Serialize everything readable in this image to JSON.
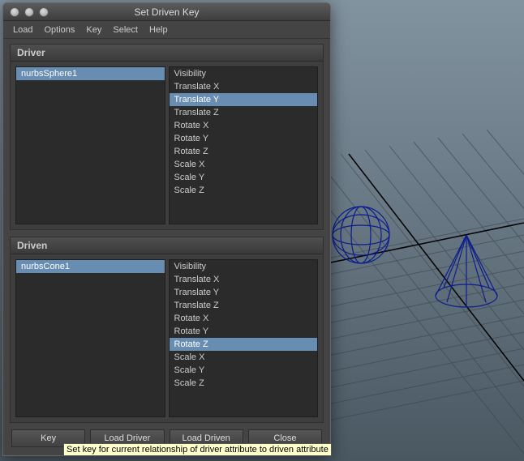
{
  "window": {
    "title": "Set Driven Key"
  },
  "menu": {
    "items": [
      "Load",
      "Options",
      "Key",
      "Select",
      "Help"
    ]
  },
  "driver": {
    "header": "Driver",
    "objects": [
      {
        "name": "nurbsSphere1",
        "selected": true
      }
    ],
    "attributes": [
      {
        "name": "Visibility",
        "selected": false
      },
      {
        "name": "Translate X",
        "selected": false
      },
      {
        "name": "Translate Y",
        "selected": true
      },
      {
        "name": "Translate Z",
        "selected": false
      },
      {
        "name": "Rotate X",
        "selected": false
      },
      {
        "name": "Rotate Y",
        "selected": false
      },
      {
        "name": "Rotate Z",
        "selected": false
      },
      {
        "name": "Scale X",
        "selected": false
      },
      {
        "name": "Scale Y",
        "selected": false
      },
      {
        "name": "Scale Z",
        "selected": false
      }
    ]
  },
  "driven": {
    "header": "Driven",
    "objects": [
      {
        "name": "nurbsCone1",
        "selected": true
      }
    ],
    "attributes": [
      {
        "name": "Visibility",
        "selected": false
      },
      {
        "name": "Translate X",
        "selected": false
      },
      {
        "name": "Translate Y",
        "selected": false
      },
      {
        "name": "Translate Z",
        "selected": false
      },
      {
        "name": "Rotate X",
        "selected": false
      },
      {
        "name": "Rotate Y",
        "selected": false
      },
      {
        "name": "Rotate Z",
        "selected": true
      },
      {
        "name": "Scale X",
        "selected": false
      },
      {
        "name": "Scale Y",
        "selected": false
      },
      {
        "name": "Scale Z",
        "selected": false
      }
    ]
  },
  "buttons": {
    "key": "Key",
    "load_driver": "Load Driver",
    "load_driven": "Load Driven",
    "close": "Close"
  },
  "tooltip": "Set key for current relationship of driver attribute to driven attribute"
}
